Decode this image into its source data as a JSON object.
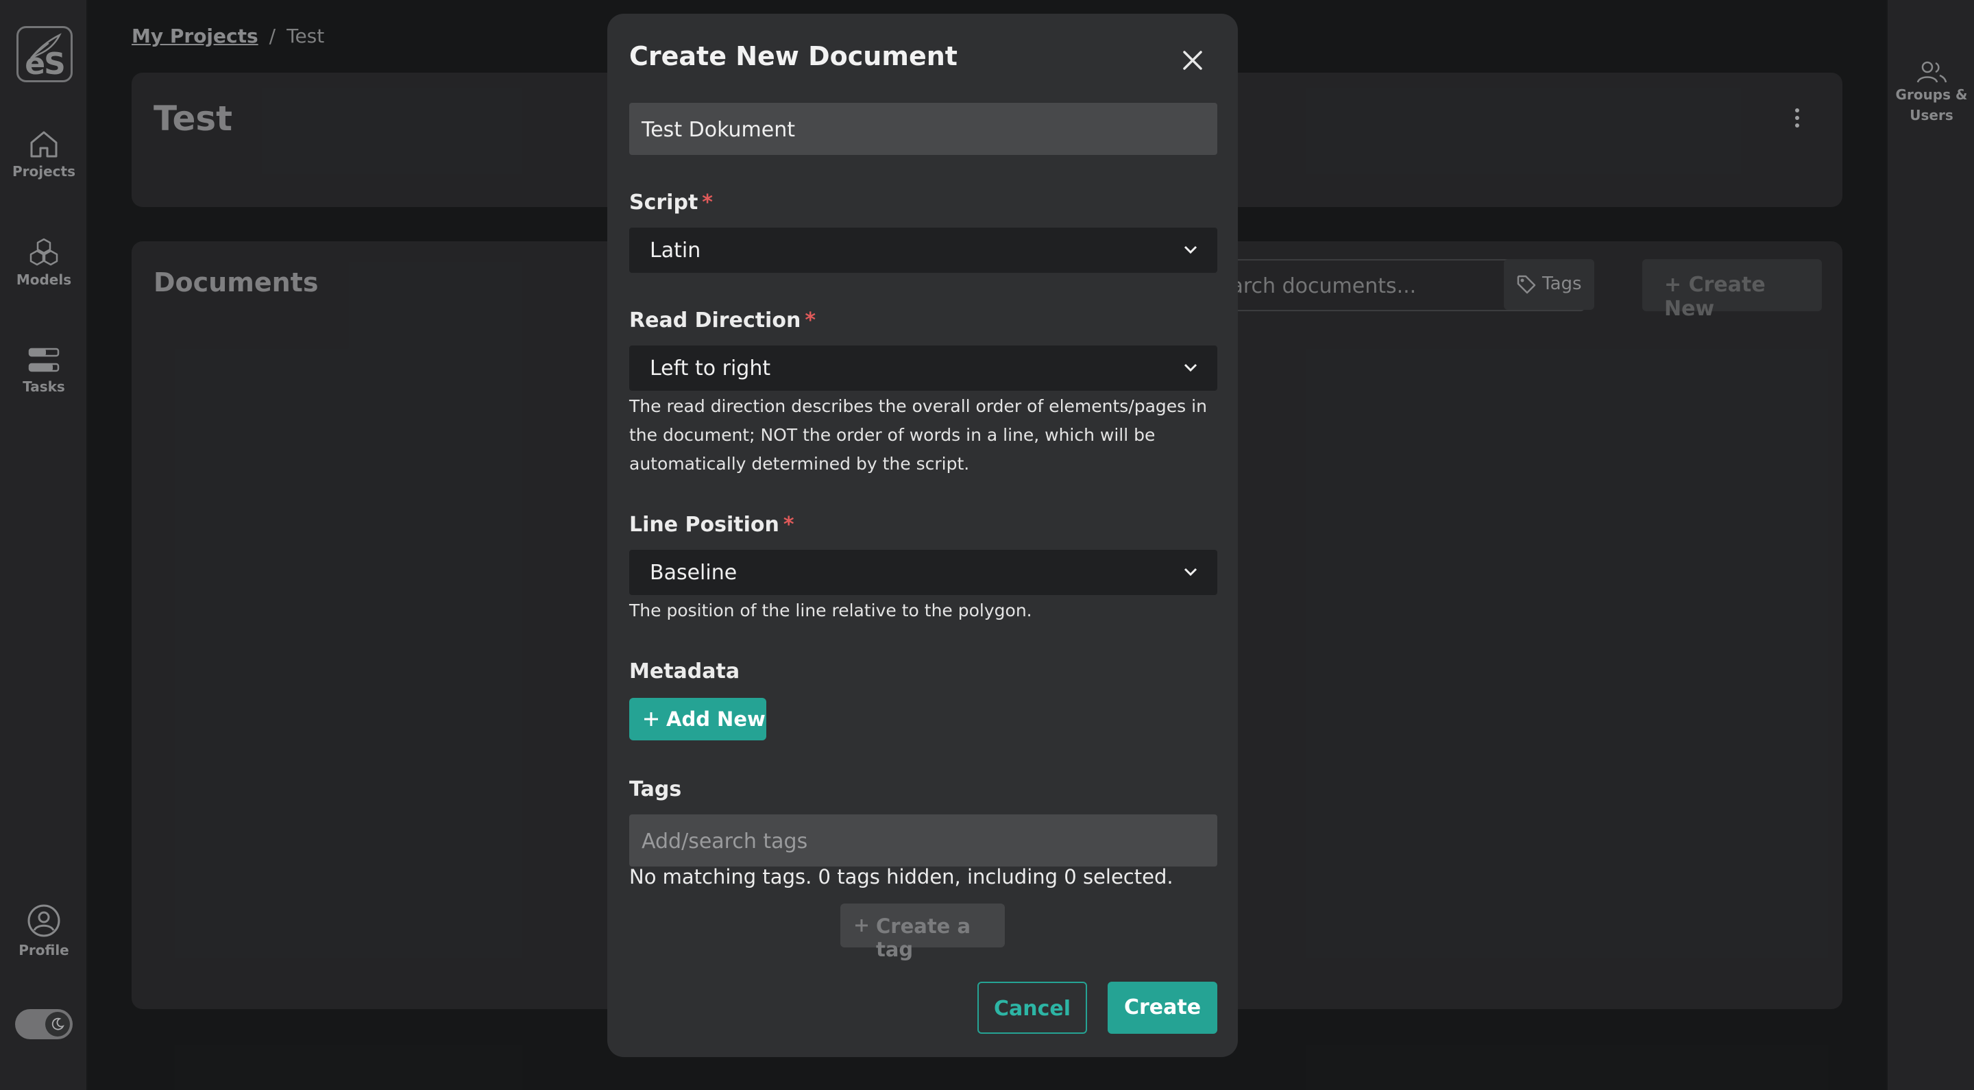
{
  "sidebar": {
    "logo_text": "eS",
    "items": [
      {
        "label": "Projects",
        "icon": "home-icon"
      },
      {
        "label": "Models",
        "icon": "cubes-icon"
      },
      {
        "label": "Tasks",
        "icon": "tasks-icon"
      }
    ],
    "profile_label": "Profile",
    "theme_toggle": "dark-mode-toggle"
  },
  "right_sidebar": {
    "line1": "Groups &",
    "line2": "Users",
    "icon": "users-icon"
  },
  "breadcrumb": {
    "root": "My Projects",
    "separator": "/",
    "current": "Test"
  },
  "project": {
    "title": "Test"
  },
  "documents": {
    "title": "Documents",
    "search_placeholder": "Search documents...",
    "tags_label": "Tags",
    "create_new_label": "+ Create New"
  },
  "modal": {
    "title": "Create New Document",
    "name_value": "Test Dokument",
    "script_label": "Script",
    "script_value": "Latin",
    "read_direction_label": "Read Direction",
    "read_direction_value": "Left to right",
    "read_direction_help": "The read direction describes the overall order of elements/pages in the document; NOT the order of words in a line, which will be automatically determined by the script.",
    "line_position_label": "Line Position",
    "line_position_value": "Baseline",
    "line_position_help": "The position of the line relative to the polygon.",
    "metadata_label": "Metadata",
    "add_new_label": "Add New",
    "tags_label": "Tags",
    "tags_placeholder": "Add/search tags",
    "no_match_text": "No matching tags. 0 tags hidden, including 0 selected.",
    "create_tag_label": "Create a tag",
    "cancel_label": "Cancel",
    "create_label": "Create",
    "required_marker": "*"
  },
  "colors": {
    "accent": "#25a394",
    "required": "#e05a5a",
    "background": "#1c1d1e",
    "panel": "#2c2d2f"
  }
}
